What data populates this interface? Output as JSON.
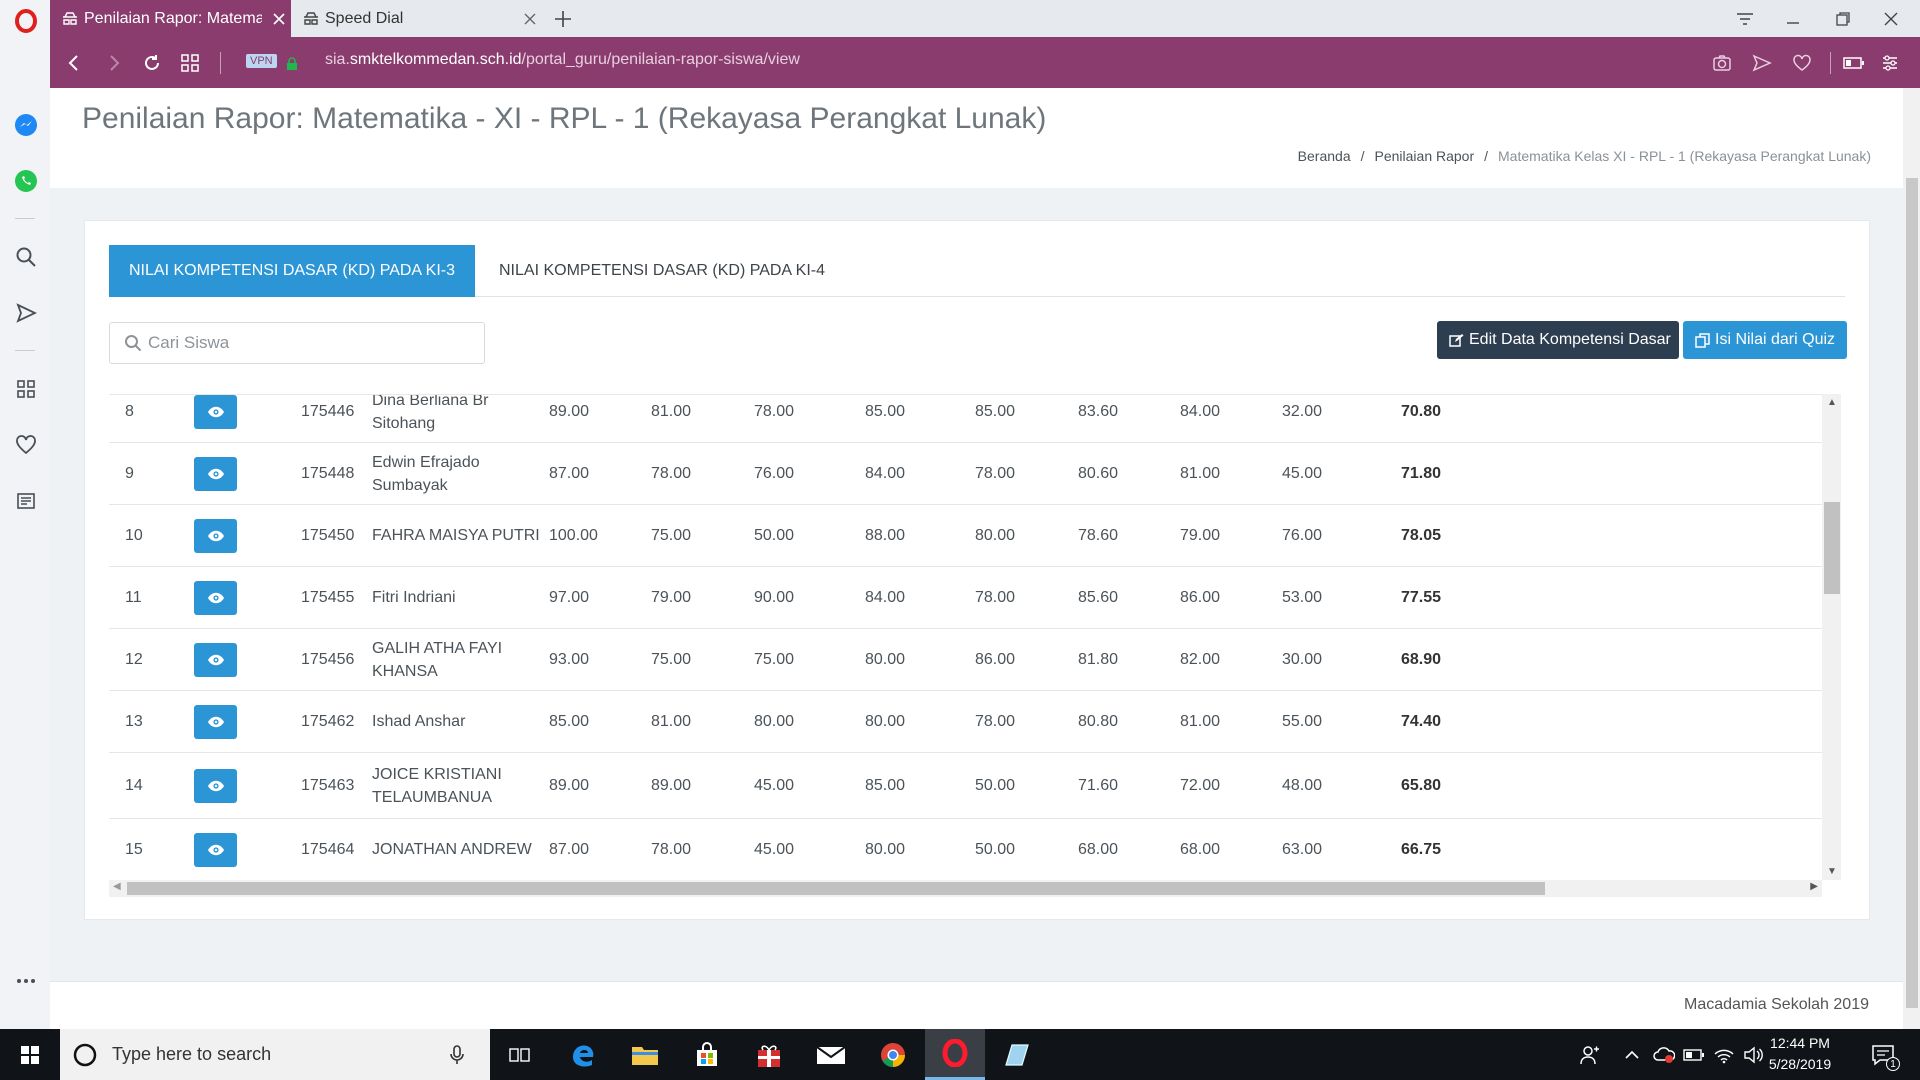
{
  "browser": {
    "tabs": [
      {
        "label": "Penilaian Rapor: Matematik",
        "active": true
      },
      {
        "label": "Speed Dial",
        "active": false
      }
    ],
    "url_prefix": "sia.",
    "url_domain": "smktelkommedan.sch.id",
    "url_path": "/portal_guru/penilaian-rapor-siswa/view",
    "vpn_label": "VPN"
  },
  "page": {
    "title": "Penilaian Rapor: Matematika - XI - RPL - 1 (Rekayasa Perangkat Lunak)",
    "breadcrumb": {
      "home": "Beranda",
      "section": "Penilaian Rapor",
      "current": "Matematika Kelas XI - RPL - 1 (Rekayasa Perangkat Lunak)",
      "separator": "/"
    },
    "tabs": [
      {
        "label": "NILAI KOMPETENSI DASAR (KD) PADA KI-3",
        "active": true
      },
      {
        "label": "NILAI KOMPETENSI DASAR (KD) PADA KI-4",
        "active": false
      }
    ],
    "search_placeholder": "Cari Siswa",
    "edit_button": "Edit Data Kompetensi Dasar",
    "quiz_button": "Isi Nilai dari Quiz",
    "footer": "Macadamia Sekolah 2019"
  },
  "table": {
    "rows": [
      {
        "no": "8",
        "nis": "175446",
        "name": "Dina Berliana Br Sitohang",
        "scores": [
          "89.00",
          "81.00",
          "78.00",
          "85.00",
          "85.00",
          "83.60",
          "84.00",
          "32.00"
        ],
        "final": "70.80"
      },
      {
        "no": "9",
        "nis": "175448",
        "name": "Edwin Efrajado Sumbayak",
        "scores": [
          "87.00",
          "78.00",
          "76.00",
          "84.00",
          "78.00",
          "80.60",
          "81.00",
          "45.00"
        ],
        "final": "71.80"
      },
      {
        "no": "10",
        "nis": "175450",
        "name": "FAHRA MAISYA PUTRI",
        "scores": [
          "100.00",
          "75.00",
          "50.00",
          "88.00",
          "80.00",
          "78.60",
          "79.00",
          "76.00"
        ],
        "final": "78.05"
      },
      {
        "no": "11",
        "nis": "175455",
        "name": "Fitri Indriani",
        "scores": [
          "97.00",
          "79.00",
          "90.00",
          "84.00",
          "78.00",
          "85.60",
          "86.00",
          "53.00"
        ],
        "final": "77.55"
      },
      {
        "no": "12",
        "nis": "175456",
        "name": "GALIH ATHA FAYI KHANSA",
        "scores": [
          "93.00",
          "75.00",
          "75.00",
          "80.00",
          "86.00",
          "81.80",
          "82.00",
          "30.00"
        ],
        "final": "68.90"
      },
      {
        "no": "13",
        "nis": "175462",
        "name": "Ishad Anshar",
        "scores": [
          "85.00",
          "81.00",
          "80.00",
          "80.00",
          "78.00",
          "80.80",
          "81.00",
          "55.00"
        ],
        "final": "74.40"
      },
      {
        "no": "14",
        "nis": "175463",
        "name": "JOICE KRISTIANI TELAUMBANUA",
        "scores": [
          "89.00",
          "89.00",
          "45.00",
          "85.00",
          "50.00",
          "71.60",
          "72.00",
          "48.00"
        ],
        "final": "65.80"
      },
      {
        "no": "15",
        "nis": "175464",
        "name": "JONATHAN ANDREW",
        "scores": [
          "87.00",
          "78.00",
          "45.00",
          "80.00",
          "50.00",
          "68.00",
          "68.00",
          "63.00"
        ],
        "final": "66.75"
      }
    ]
  },
  "taskbar": {
    "search_placeholder": "Type here to search",
    "time": "12:44 PM",
    "date": "5/28/2019",
    "notification_count": "1"
  },
  "colors": {
    "accent": "#2b95d6",
    "browser_bar": "#8a3c6e",
    "dark_button": "#2c3e50"
  }
}
